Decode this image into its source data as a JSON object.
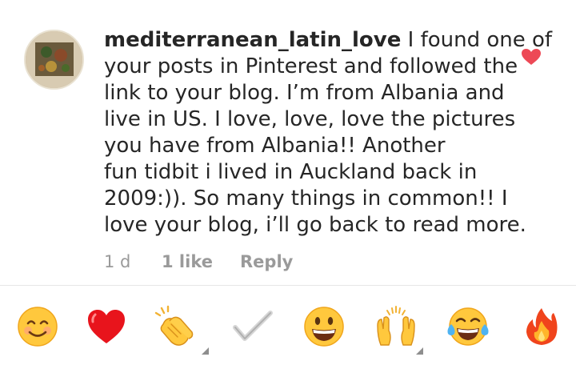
{
  "comment": {
    "username": "mediterranean_latin_love",
    "text_lines": [
      " I found one of",
      "your posts in Pinterest and followed the",
      "link to your blog. I’m from Albania and",
      "live in US. I love, love, love the pictures",
      "you have from Albania!! Another",
      "fun tidbit i lived in Auckland back in",
      "2009:)). So many things in common!! I",
      "love your blog, i’ll go back to read more."
    ],
    "time": "1 d",
    "likes": "1 like",
    "reply_label": "Reply",
    "liked": true
  },
  "reactions": [
    {
      "icon": "smiling-face-icon",
      "has_variants": false
    },
    {
      "icon": "red-heart-icon",
      "has_variants": false
    },
    {
      "icon": "clapping-hands-icon",
      "has_variants": true
    },
    {
      "icon": "check-mark-icon",
      "has_variants": false
    },
    {
      "icon": "grinning-face-icon",
      "has_variants": false
    },
    {
      "icon": "raising-hands-icon",
      "has_variants": true
    },
    {
      "icon": "tears-of-joy-face-icon",
      "has_variants": false
    },
    {
      "icon": "fire-icon",
      "has_variants": false
    }
  ],
  "colors": {
    "like_heart": "#ed4956",
    "meta_text": "#9a9a9a"
  }
}
